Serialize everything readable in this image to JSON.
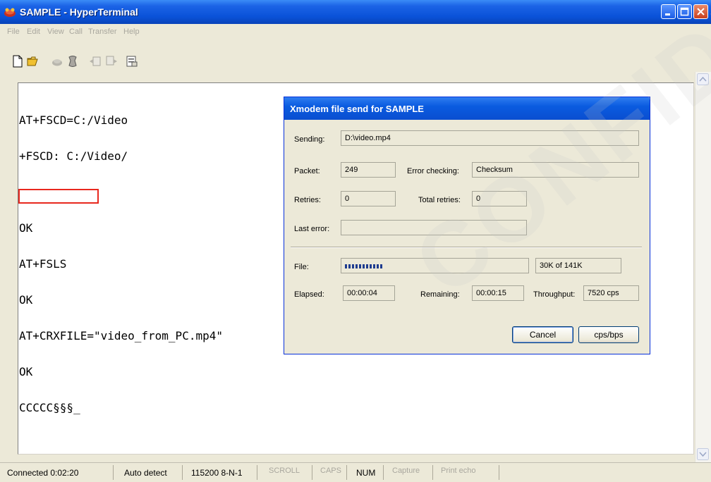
{
  "window": {
    "title": "SAMPLE - HyperTerminal",
    "icon": "hyperterminal-phone-icon"
  },
  "menu": [
    "File",
    "Edit",
    "View",
    "Call",
    "Transfer",
    "Help"
  ],
  "toolbar": [
    "new-icon",
    "open-icon",
    "disconnect-icon",
    "dial-icon",
    "send-icon",
    "receive-icon",
    "properties-icon"
  ],
  "terminal": {
    "lines": [
      "AT+FSCD=C:/Video",
      "+FSCD: C:/Video/",
      "",
      "OK",
      "AT+FSLS",
      "OK",
      "AT+CRXFILE=\"video_from_PC.mp4\"",
      "OK",
      "CCCCC§§§_"
    ]
  },
  "dialog": {
    "title": "Xmodem file send for SAMPLE",
    "sending_label": "Sending:",
    "sending_value": "D:\\video.mp4",
    "packet_label": "Packet:",
    "packet_value": "249",
    "error_checking_label": "Error checking:",
    "error_checking_value": "Checksum",
    "retries_label": "Retries:",
    "retries_value": "0",
    "total_retries_label": "Total retries:",
    "total_retries_value": "0",
    "last_error_label": "Last error:",
    "last_error_value": "",
    "file_label": "File:",
    "file_progress_text": "30K of 141K",
    "file_progress_fraction": 0.213,
    "elapsed_label": "Elapsed:",
    "elapsed_value": "00:00:04",
    "remaining_label": "Remaining:",
    "remaining_value": "00:00:15",
    "throughput_label": "Throughput:",
    "throughput_value": "7520 cps",
    "cancel_label": "Cancel",
    "cps_bps_label": "cps/bps"
  },
  "status": {
    "connected": "Connected 0:02:20",
    "detect": "Auto detect",
    "port": "115200 8-N-1",
    "scroll": "SCROLL",
    "caps": "CAPS",
    "num": "NUM",
    "capture": "Capture",
    "print_echo": "Print echo"
  },
  "colors": {
    "titlebar": "#0a52d8",
    "highlight_box": "#e8281e",
    "progress_fill": "#1f3c8f"
  },
  "watermark": "CONFIDENTIAL"
}
